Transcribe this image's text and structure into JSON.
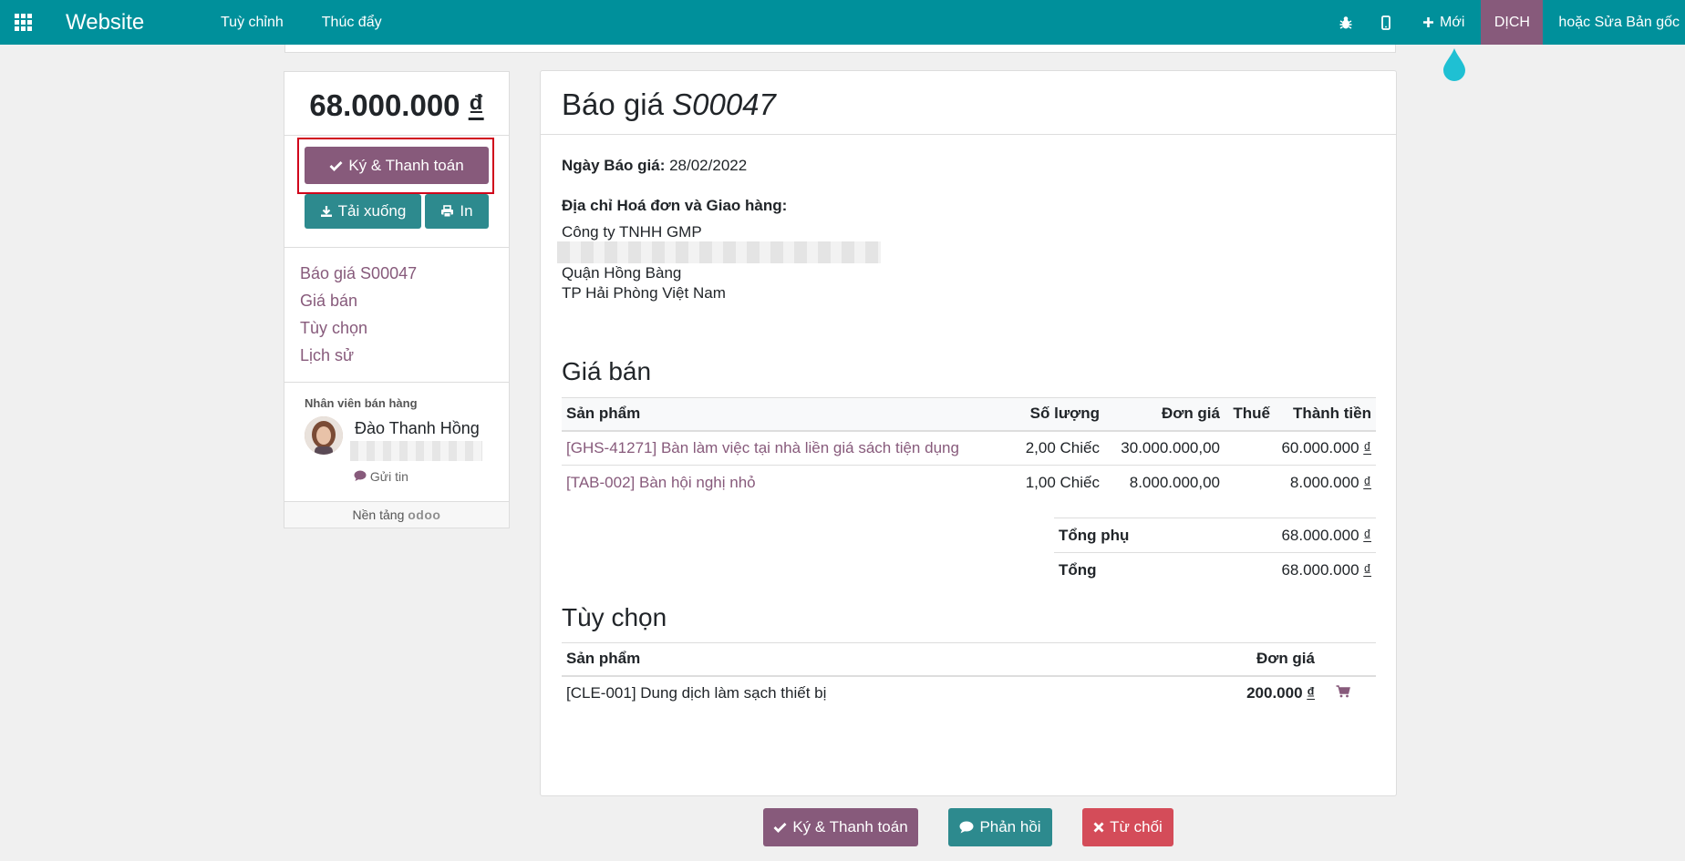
{
  "navbar": {
    "brand": "Website",
    "menu": [
      "Tuỳ chỉnh",
      "Thúc đẩy"
    ],
    "new_label": "Mới",
    "translate_label": "DỊCH",
    "edit_label": "hoặc Sửa Bản gốc"
  },
  "sidebar": {
    "amount": "68.000.000",
    "currency": "₫",
    "sign_label": "Ký & Thanh toán",
    "download_label": "Tải xuống",
    "print_label": "In",
    "links": [
      "Báo giá S00047",
      "Giá bán",
      "Tùy chọn",
      "Lịch sử"
    ],
    "salesperson_label": "Nhân viên bán hàng",
    "salesperson_name": "Đào Thanh Hồng",
    "message_label": "Gửi tin",
    "powered_by": "Nền tảng",
    "powered_logo": "odoo"
  },
  "quote": {
    "title_prefix": "Báo giá",
    "number": "S00047",
    "date_label": "Ngày Báo giá:",
    "date_value": "28/02/2022",
    "address_label": "Địa chỉ Hoá đơn và Giao hàng:",
    "address_lines": [
      "Công ty TNHH GMP",
      "Quận Hồng Bàng",
      "TP Hải Phòng Việt Nam"
    ]
  },
  "pricing": {
    "title": "Giá bán",
    "headers": [
      "Sản phẩm",
      "Số lượng",
      "Đơn giá",
      "Thuế",
      "Thành tiền"
    ],
    "rows": [
      {
        "product": "[GHS-41271] Bàn làm việc tại nhà liền giá sách tiện dụng",
        "qty": "2,00 Chiếc",
        "price": "30.000.000,00",
        "tax": "",
        "subtotal": "60.000.000"
      },
      {
        "product": "[TAB-002] Bàn hội nghị nhỏ",
        "qty": "1,00 Chiếc",
        "price": "8.000.000,00",
        "tax": "",
        "subtotal": "8.000.000"
      }
    ],
    "subtotal_label": "Tổng phụ",
    "subtotal_value": "68.000.000",
    "total_label": "Tổng",
    "total_value": "68.000.000",
    "currency": "₫"
  },
  "options": {
    "title": "Tùy chọn",
    "headers": [
      "Sản phẩm",
      "Đơn giá"
    ],
    "rows": [
      {
        "product": "[CLE-001] Dung dịch làm sạch thiết bị",
        "price": "200.000"
      }
    ]
  },
  "footer_buttons": {
    "sign_label": "Ký & Thanh toán",
    "feedback_label": "Phản hồi",
    "reject_label": "Từ chối"
  },
  "colors": {
    "navbar": "#00909b",
    "primary": "#875a7b",
    "teal_button": "#2d8a8e",
    "danger": "#d44c59",
    "highlight": "#d0021b"
  }
}
